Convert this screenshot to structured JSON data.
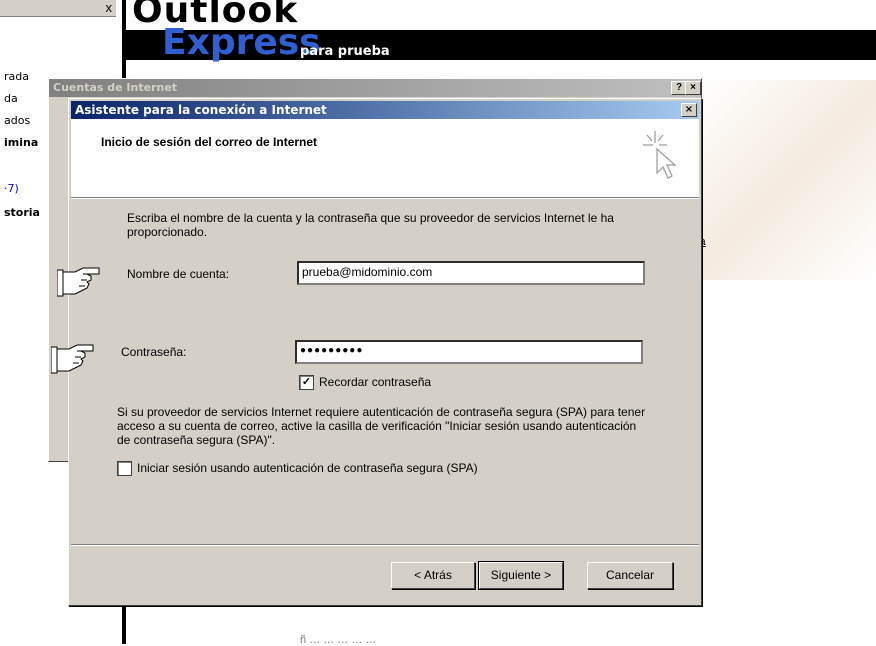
{
  "background": {
    "close_glyph": "x",
    "title_line1": "Outlook",
    "title_line2": "Express",
    "title_line3": "para prueba",
    "left_fragments": [
      "rada",
      "da",
      "ados",
      "imina",
      "·7)",
      "storia"
    ],
    "right_link_fragment": "la",
    "bottom_fragment": "ñ …           … …             …  …"
  },
  "accounts_window": {
    "title": "Cuentas de Internet",
    "help_button": "?",
    "close_button": "×"
  },
  "wizard": {
    "title": "Asistente para la conexión a Internet",
    "close_button": "×",
    "header_title": "Inicio de sesión del correo de Internet",
    "intro_text": "Escriba el nombre de la cuenta y la contraseña que su proveedor de servicios Internet le ha proporcionado.",
    "account_label": "Nombre de cuenta:",
    "account_value": "prueba@midominio.com",
    "password_label": "Contraseña:",
    "password_value": "●●●●●●●●●",
    "remember_password_label": "Recordar contraseña",
    "remember_password_checked": "✓",
    "spa_text": "Si su proveedor de servicios Internet requiere autenticación de contraseña segura (SPA) para tener acceso a su cuenta de correo, active la casilla de verificación \"Iniciar sesión usando autenticación de contraseña segura (SPA)\".",
    "spa_checkbox_label": "Iniciar sesión usando autenticación de contraseña segura (SPA)",
    "back_button": "< Atrás",
    "next_button": "Siguiente >",
    "cancel_button": "Cancelar"
  },
  "colors": {
    "active_titlebar": "#0a246a",
    "inactive_titlebar": "#808080",
    "dialog_face": "#d4d0c8",
    "express_blue": "#2f5fd0"
  }
}
